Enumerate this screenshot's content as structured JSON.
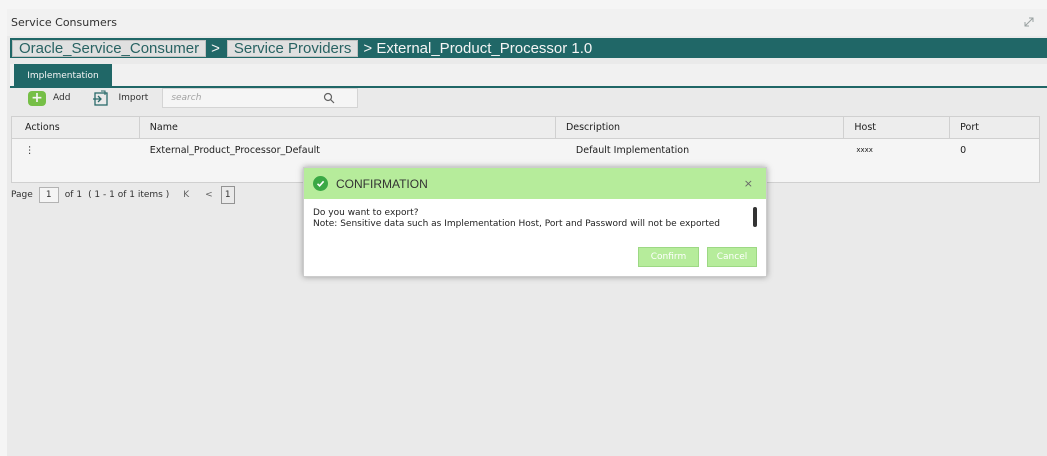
{
  "window": {
    "title": "Service Consumers"
  },
  "breadcrumb": {
    "items": [
      "Oracle_Service_Consumer",
      "Service Providers"
    ],
    "separator": ">",
    "current": "> External_Product_Processor 1.0"
  },
  "tabs": [
    {
      "label": "Implementation"
    }
  ],
  "toolbar": {
    "add_label": "Add",
    "import_label": "Import",
    "search_placeholder": "search"
  },
  "table": {
    "columns": [
      "Actions",
      "Name",
      "Description",
      "Host",
      "Port"
    ],
    "rows": [
      {
        "actions": "⋮",
        "name": "External_Product_Processor_Default",
        "description": "Default Implementation",
        "host": "xxxx",
        "port": "0"
      }
    ]
  },
  "pager": {
    "page_label": "Page",
    "page": "1",
    "of": "of 1",
    "items": "( 1 - 1 of 1 items )",
    "first": "K",
    "prev": "<",
    "current": "1"
  },
  "dialog": {
    "title": "CONFIRMATION",
    "close": "×",
    "line1": "Do you want to export?",
    "line2": "Note: Sensitive data such as Implementation Host, Port and Password will not be exported",
    "confirm": "Confirm",
    "cancel": "Cancel"
  },
  "colors": {
    "accent": "#226c6c",
    "dialog_header": "#b6ec9b",
    "success": "#3aa845",
    "add_green": "#7bc74a"
  }
}
